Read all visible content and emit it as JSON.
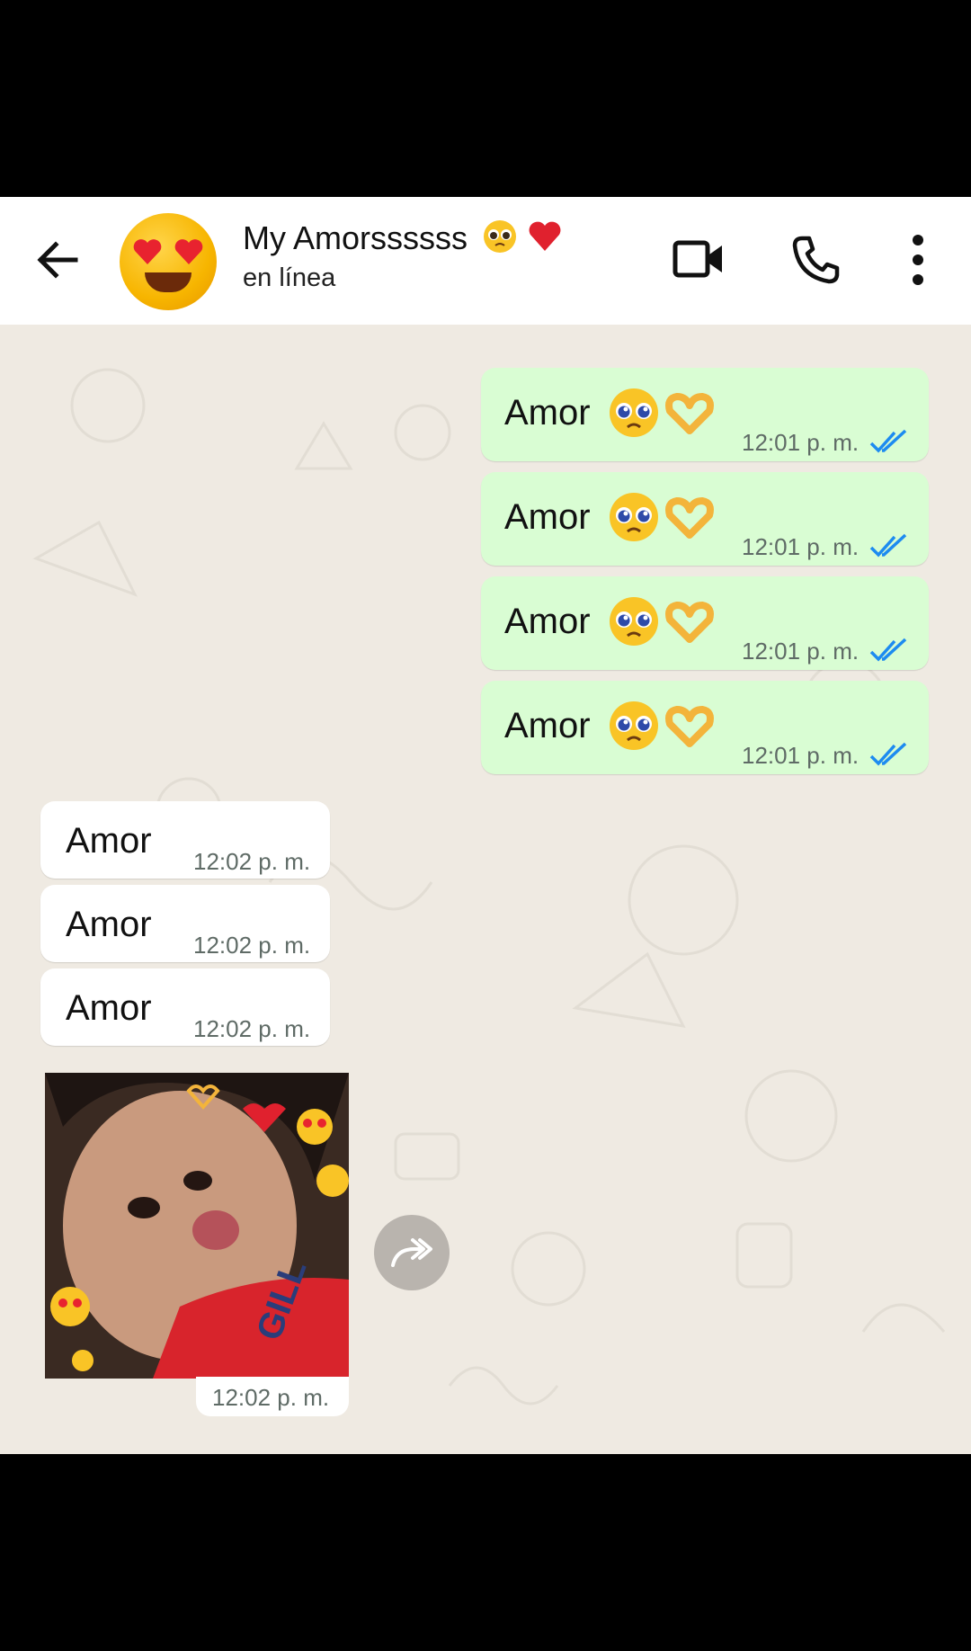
{
  "header": {
    "back_icon": "arrow-left-icon",
    "avatar_icon": "heart-eyes-emoji",
    "contact_name": "My Amorssssss",
    "contact_status": "en línea",
    "actions": [
      "video-call-icon",
      "phone-call-icon",
      "more-vert-icon"
    ]
  },
  "messages": {
    "outgoing": [
      {
        "text": "Amor",
        "time": "12:01 p. m.",
        "emojis": [
          "pleading-face",
          "heart-hands"
        ],
        "read": true
      },
      {
        "text": "Amor",
        "time": "12:01 p. m.",
        "emojis": [
          "pleading-face",
          "heart-hands"
        ],
        "read": true
      },
      {
        "text": "Amor",
        "time": "12:01 p. m.",
        "emojis": [
          "pleading-face",
          "heart-hands"
        ],
        "read": true
      },
      {
        "text": "Amor",
        "time": "12:01 p. m.",
        "emojis": [
          "pleading-face",
          "heart-hands"
        ],
        "read": true
      }
    ],
    "incoming": [
      {
        "text": "Amor",
        "time": "12:02 p. m."
      },
      {
        "text": "Amor",
        "time": "12:02 p. m."
      },
      {
        "text": "Amor",
        "time": "12:02 p. m."
      }
    ],
    "photo": {
      "time": "12:02 p. m.",
      "sticker_emojis": [
        "heart-hands",
        "heart-eyes",
        "pleading-face",
        "bandaged-heart"
      ]
    }
  },
  "colors": {
    "outgoing_bubble": "#d9fdd3",
    "incoming_bubble": "#ffffff",
    "chat_background": "#efeae2",
    "read_ticks": "#1d8bf0"
  }
}
